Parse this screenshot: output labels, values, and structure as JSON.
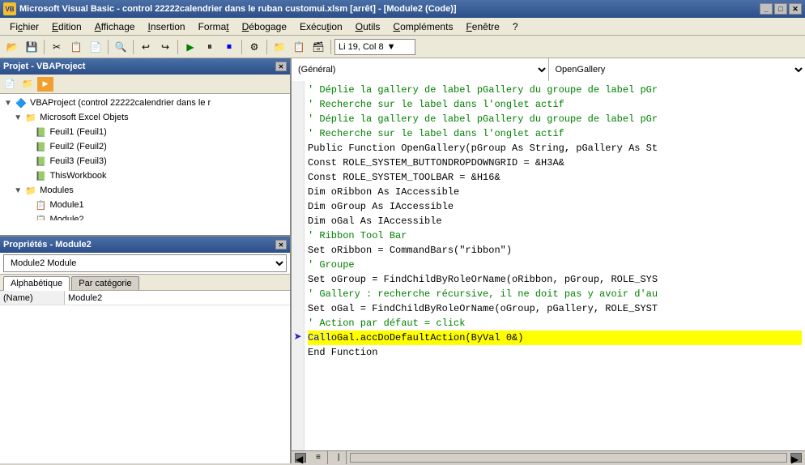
{
  "titlebar": {
    "icon": "VB",
    "text": "Microsoft Visual Basic - control 22222calendrier dans le ruban customui.xlsm [arrêt] - [Module2 (Code)]",
    "min": "_",
    "max": "□",
    "close": "✕"
  },
  "menubar": {
    "items": [
      {
        "label": "Fichier",
        "underline": "F"
      },
      {
        "label": "Edition",
        "underline": "E"
      },
      {
        "label": "Affichage",
        "underline": "A"
      },
      {
        "label": "Insertion",
        "underline": "I"
      },
      {
        "label": "Format",
        "underline": "t"
      },
      {
        "label": "Débogage",
        "underline": "D"
      },
      {
        "label": "Exécution",
        "underline": "E"
      },
      {
        "label": "Outils",
        "underline": "O"
      },
      {
        "label": "Compléments",
        "underline": "C"
      },
      {
        "label": "Fenêtre",
        "underline": "F"
      },
      {
        "label": "?",
        "underline": ""
      }
    ]
  },
  "toolbar": {
    "position_label": "Li 19, Col 8"
  },
  "project_panel": {
    "title": "Projet - VBAProject",
    "tree": [
      {
        "indent": 0,
        "expand": "▼",
        "icon": "📁",
        "label": "VBAProject (control 22222calendrier dans le r",
        "type": "project"
      },
      {
        "indent": 1,
        "expand": "▼",
        "icon": "📁",
        "label": "Microsoft Excel Objets",
        "type": "folder"
      },
      {
        "indent": 2,
        "expand": "",
        "icon": "📄",
        "label": "Feuil1 (Feuil1)",
        "type": "sheet"
      },
      {
        "indent": 2,
        "expand": "",
        "icon": "📄",
        "label": "Feuil2 (Feuil2)",
        "type": "sheet"
      },
      {
        "indent": 2,
        "expand": "",
        "icon": "📄",
        "label": "Feuil3 (Feuil3)",
        "type": "sheet"
      },
      {
        "indent": 2,
        "expand": "",
        "icon": "📗",
        "label": "ThisWorkbook",
        "type": "workbook"
      },
      {
        "indent": 1,
        "expand": "▼",
        "icon": "📁",
        "label": "Modules",
        "type": "folder"
      },
      {
        "indent": 2,
        "expand": "",
        "icon": "📋",
        "label": "Module1",
        "type": "module"
      },
      {
        "indent": 2,
        "expand": "",
        "icon": "📋",
        "label": "Module2",
        "type": "module"
      }
    ]
  },
  "properties_panel": {
    "title": "Propriétés - Module2",
    "module_name": "Module2",
    "type": "Module",
    "tabs": [
      "Alphabétique",
      "Par catégorie"
    ],
    "active_tab": 0,
    "combo_value": "Module2  Module",
    "rows": [
      {
        "key": "(Name)",
        "value": "Module2"
      }
    ]
  },
  "code_editor": {
    "combo_left": "(Général)",
    "combo_right": "OpenGallery",
    "lines": [
      {
        "type": "comment",
        "text": "' Déplie la gallery de label pGallery du groupe de label pGr"
      },
      {
        "type": "comment",
        "text": "' Recherche sur le label dans l'onglet actif"
      },
      {
        "type": "comment",
        "text": "' Déplie la gallery de label pGallery du groupe de label pGr"
      },
      {
        "type": "comment",
        "text": "' Recherche sur le label dans l'onglet actif"
      },
      {
        "type": "code",
        "text": "Public Function OpenGallery(pGroup As String, pGallery As St"
      },
      {
        "type": "code",
        "text": "Const ROLE_SYSTEM_BUTTONDROPDOWNGRID = &H3A&"
      },
      {
        "type": "code",
        "text": "Const ROLE_SYSTEM_TOOLBAR = &H16&"
      },
      {
        "type": "code",
        "text": "Dim oRibbon As IAccessible"
      },
      {
        "type": "code",
        "text": "Dim oGroup As IAccessible"
      },
      {
        "type": "code",
        "text": "Dim oGal As IAccessible"
      },
      {
        "type": "comment",
        "text": "' Ribbon Tool Bar"
      },
      {
        "type": "code",
        "text": "Set oRibbon = CommandBars(\"ribbon\")"
      },
      {
        "type": "comment",
        "text": "' Groupe"
      },
      {
        "type": "code",
        "text": "Set oGroup = FindChildByRoleOrName(oRibbon, pGroup, ROLE_SYS"
      },
      {
        "type": "comment",
        "text": "' Gallery : recherche récursive, il ne doit pas y avoir d'au"
      },
      {
        "type": "code",
        "text": "Set oGal = FindChildByRoleOrName(oGroup, pGallery, ROLE_SYST"
      },
      {
        "type": "comment",
        "text": "' Action par défaut = click"
      },
      {
        "type": "highlighted",
        "text": "Call oGal.accDoDefaultAction(ByVal 0&)"
      },
      {
        "type": "code",
        "text": "End Function"
      }
    ],
    "arrow_line": 18
  }
}
